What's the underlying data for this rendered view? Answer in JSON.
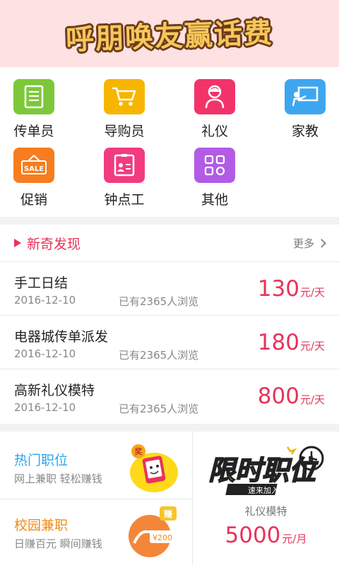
{
  "banner": {
    "title": "呼朋唤友赢话费"
  },
  "categories": [
    {
      "label": "传单员",
      "icon": "document-icon",
      "color": "#7cc83a"
    },
    {
      "label": "导购员",
      "icon": "cart-icon",
      "color": "#f7b500"
    },
    {
      "label": "礼仪",
      "icon": "hostess-icon",
      "color": "#f2336a"
    },
    {
      "label": "家教",
      "icon": "tutor-board-icon",
      "color": "#3ea6ef"
    },
    {
      "label": "促销",
      "icon": "sale-tag-icon",
      "color": "#f77d1f"
    },
    {
      "label": "钟点工",
      "icon": "id-card-icon",
      "color": "#f23b80"
    },
    {
      "label": "其他",
      "icon": "grid-apps-icon",
      "color": "#b25be6"
    }
  ],
  "discover": {
    "title": "新奇发现",
    "more_label": "更多",
    "jobs": [
      {
        "title": "手工日结",
        "date": "2016-12-10",
        "views": "已有2365人浏览",
        "pay": "130",
        "unit": "元/天"
      },
      {
        "title": "电器城传单派发",
        "date": "2016-12-10",
        "views": "已有2365人浏览",
        "pay": "180",
        "unit": "元/天"
      },
      {
        "title": "高新礼仪模特",
        "date": "2016-12-10",
        "views": "已有2365人浏览",
        "pay": "800",
        "unit": "元/天"
      }
    ]
  },
  "hot": {
    "title": "热门职位",
    "subtitle": "网上兼职   轻松赚钱",
    "color": "#2fa6e8",
    "badge": "奖"
  },
  "campus": {
    "title": "校园兼职",
    "subtitle": "日赚百元   瞬间赚钱",
    "color": "#f08c1a",
    "badge": "赚",
    "amount": "¥200"
  },
  "limited": {
    "logo_text": "限时职位",
    "logo_sub": "速来加入",
    "job": "礼仪模特",
    "pay": "5000",
    "unit": "元/月"
  }
}
